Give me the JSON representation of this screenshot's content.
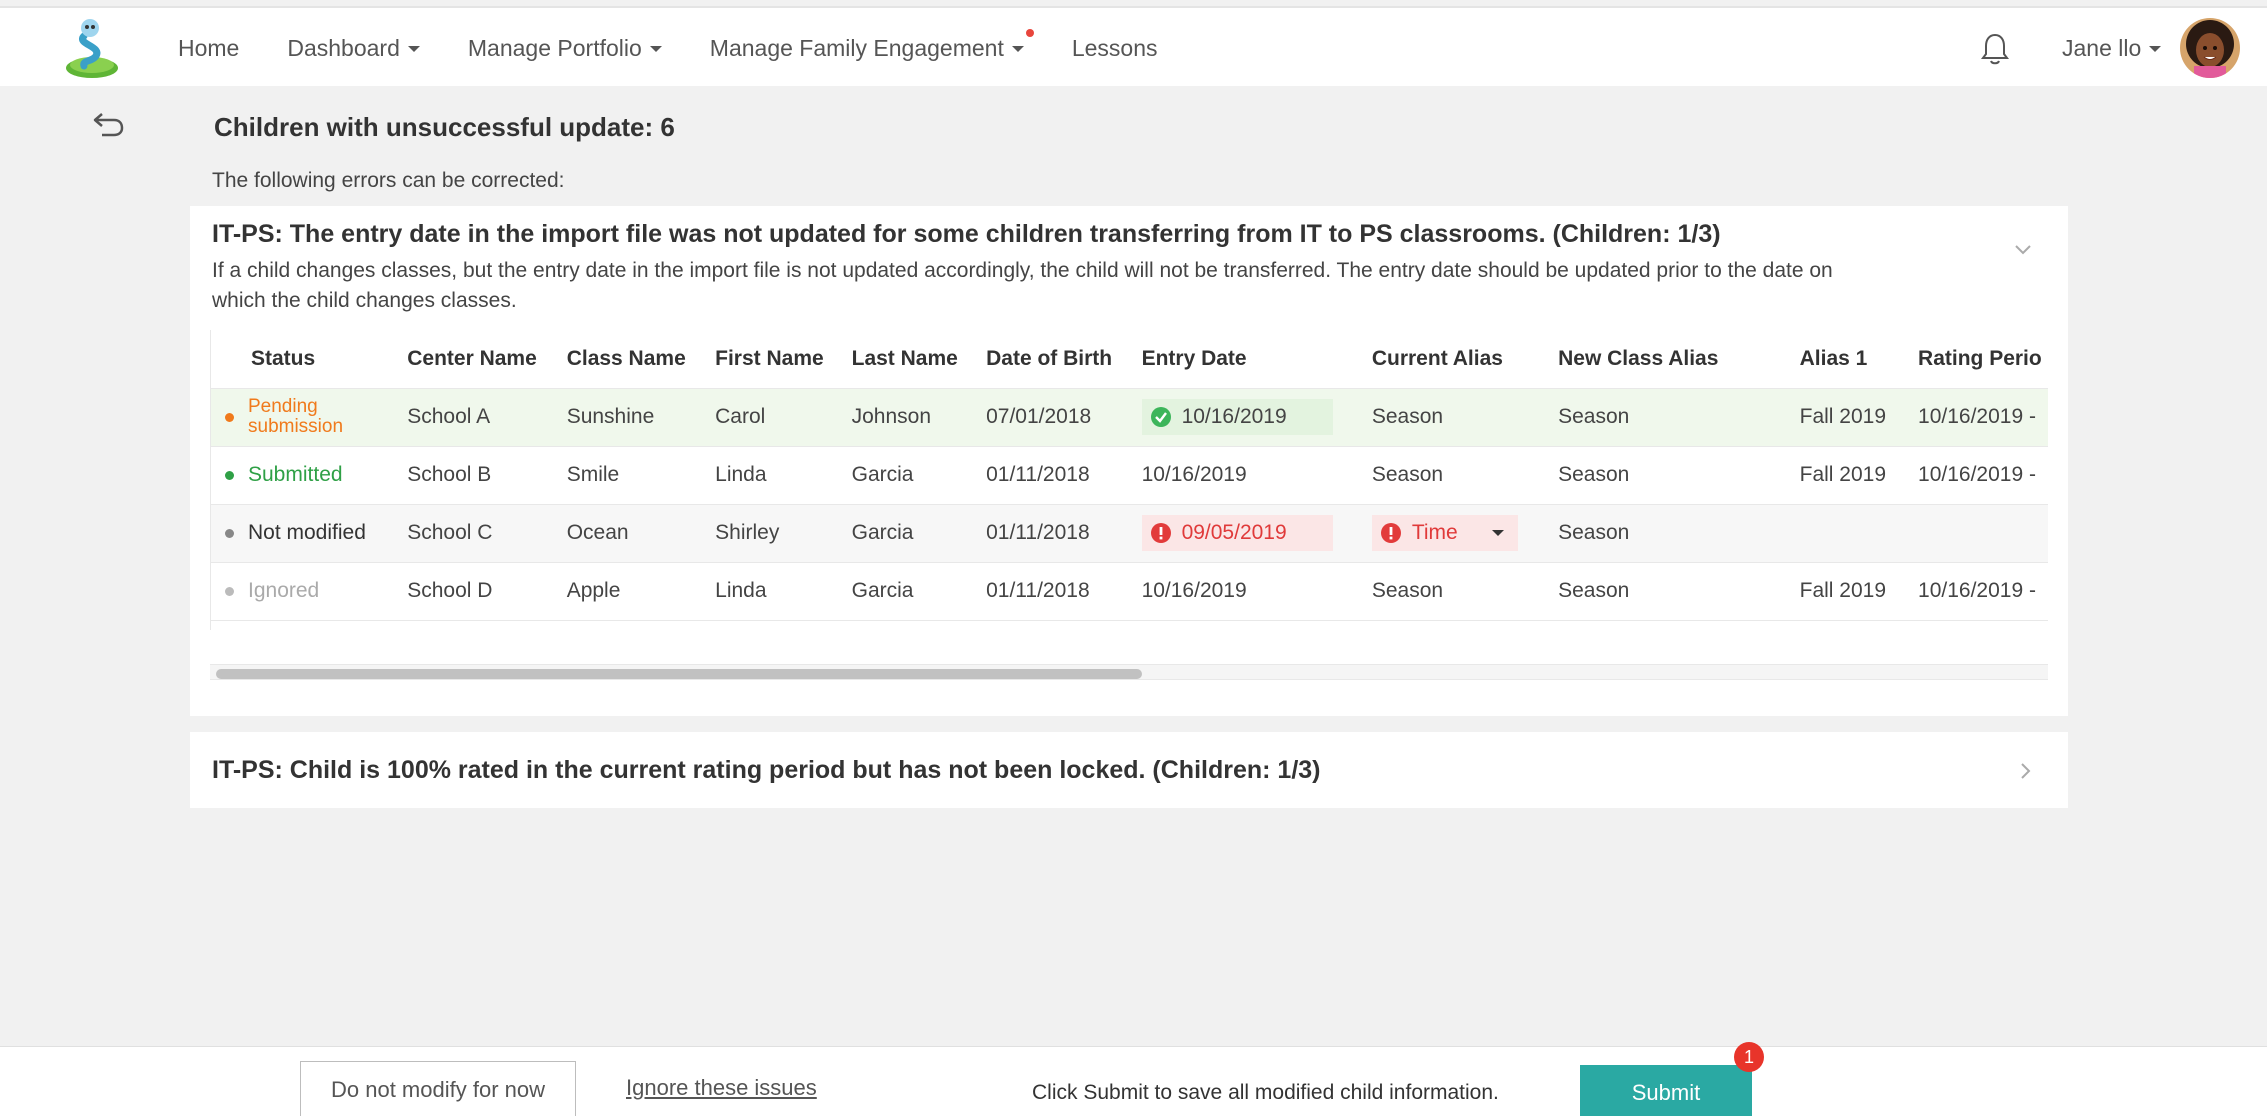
{
  "nav": {
    "items": [
      {
        "label": "Home",
        "dropdown": false
      },
      {
        "label": "Dashboard",
        "dropdown": true
      },
      {
        "label": "Manage Portfolio",
        "dropdown": true
      },
      {
        "label": "Manage Family Engagement",
        "dropdown": true,
        "notification_dot": true
      },
      {
        "label": "Lessons",
        "dropdown": false
      }
    ],
    "user_name": "Jane llo",
    "icons": {
      "logo": "app-logo-icon",
      "bell": "bell-icon",
      "avatar": "user-avatar"
    }
  },
  "page": {
    "heading": "Children with unsuccessful update: 6",
    "subheading": "The following errors can be corrected:"
  },
  "issues": [
    {
      "title": "IT-PS: The entry date in the import file was not updated for some children transferring from IT to PS classrooms. (Children: 1/3)",
      "description": "If a child changes classes, but the entry date in the import file is not updated accordingly, the child will not be transferred. The entry date should be updated prior to the date on which the child changes classes.",
      "expanded": true,
      "columns": [
        "Status",
        "Center Name",
        "Class Name",
        "First Name",
        "Last Name",
        "Date of Birth",
        "Entry Date",
        "Current Alias",
        "New Class Alias",
        "Alias 1",
        "Rating Perio"
      ],
      "rows": [
        {
          "status_line1": "Pending",
          "status_line2": "submission",
          "center": "School A",
          "class": "Sunshine",
          "first": "Carol",
          "last": "Johnson",
          "dob": "07/01/2018",
          "entry": "10/16/2019",
          "current_alias": "Season",
          "new_alias": "Season",
          "alias1": "Fall 2019",
          "rating": "10/16/2019 -"
        },
        {
          "status": "Submitted",
          "center": "School B",
          "class": "Smile",
          "first": "Linda",
          "last": "Garcia",
          "dob": "01/11/2018",
          "entry": "10/16/2019",
          "current_alias": "Season",
          "new_alias": "Season",
          "alias1": "Fall 2019",
          "rating": "10/16/2019 -"
        },
        {
          "status": "Not modified",
          "center": "School C",
          "class": "Ocean",
          "first": "Shirley",
          "last": "Garcia",
          "dob": "01/11/2018",
          "entry": "09/05/2019",
          "current_alias": "Time",
          "new_alias": "Season",
          "alias1": "",
          "rating": ""
        },
        {
          "status": "Ignored",
          "center": "School D",
          "class": "Apple",
          "first": "Linda",
          "last": "Garcia",
          "dob": "01/11/2018",
          "entry": "10/16/2019",
          "current_alias": "Season",
          "new_alias": "Season",
          "alias1": "Fall 2019",
          "rating": "10/16/2019 -"
        }
      ],
      "status_colors": {
        "pending": "#f07a1c",
        "submitted": "#2fa046",
        "not_modified": "#333333",
        "ignored": "#aaaaaa"
      },
      "scroll_fraction": 0.5
    },
    {
      "title": "IT-PS: Child is 100% rated in the current rating period but has not been locked.  (Children: 1/3)",
      "expanded": false
    }
  ],
  "footer": {
    "do_not_modify": "Do not modify for now",
    "ignore_link": "Ignore these issues",
    "hint": "Click Submit to save all modified child information.",
    "submit": "Submit",
    "badge_count": "1",
    "accent": "#2aa9a3"
  }
}
